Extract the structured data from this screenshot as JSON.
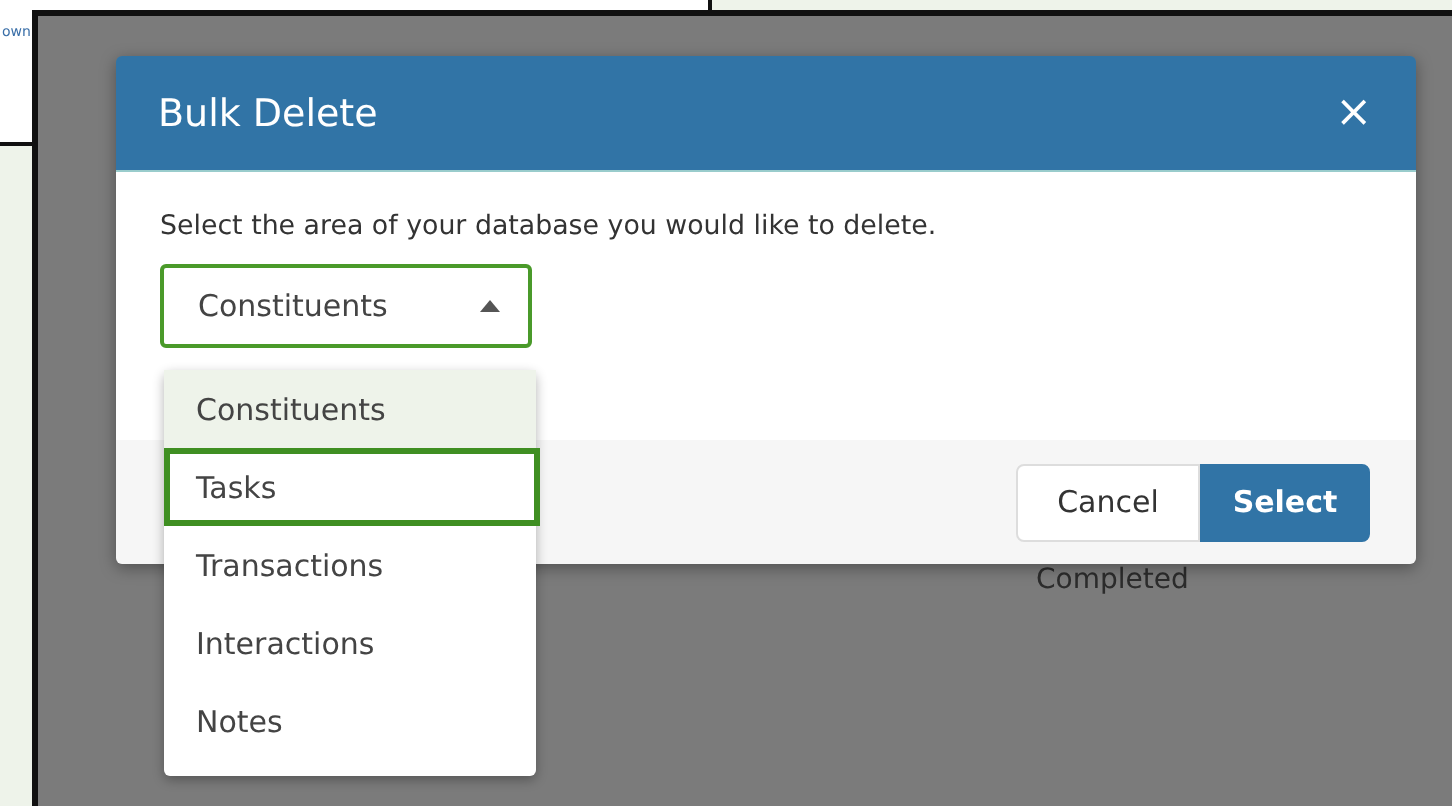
{
  "background": {
    "link": "own",
    "status_cell": "Completed"
  },
  "dialog": {
    "title": "Bulk Delete",
    "close": "×",
    "prompt": "Select the area of your database you would like to delete.",
    "dropdown": {
      "value": "Constituents",
      "expanded": true,
      "options": [
        {
          "label": "Constituents",
          "selected": true,
          "highlighted": false
        },
        {
          "label": "Tasks",
          "selected": false,
          "highlighted": true
        },
        {
          "label": "Transactions",
          "selected": false,
          "highlighted": false
        },
        {
          "label": "Interactions",
          "selected": false,
          "highlighted": false
        },
        {
          "label": "Notes",
          "selected": false,
          "highlighted": false
        }
      ]
    },
    "buttons": [
      {
        "label": "Cancel",
        "kind": "secondary"
      },
      {
        "label": "Select",
        "kind": "primary"
      }
    ]
  }
}
